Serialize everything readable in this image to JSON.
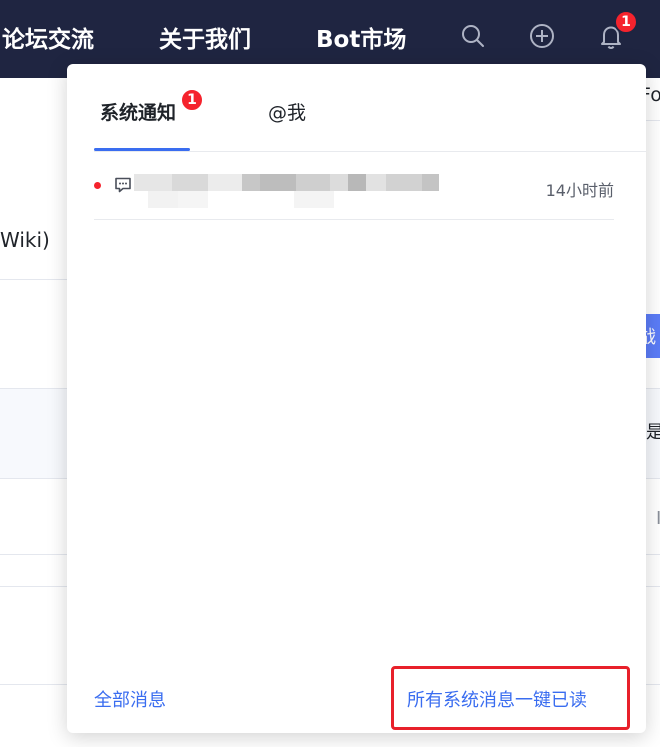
{
  "navbar": {
    "links": [
      "论坛交流",
      "关于我们",
      "Bot市场"
    ],
    "icons": [
      "search-icon",
      "plus-circle-icon",
      "bell-icon"
    ],
    "bell_badge": "1"
  },
  "background": {
    "texts": [
      "Wiki)",
      "Fo",
      "战",
      "是",
      "I"
    ]
  },
  "notifications": {
    "tabs": [
      {
        "label": "系统通知",
        "badge": "1",
        "active": true
      },
      {
        "label": "@我",
        "active": false
      }
    ],
    "items": [
      {
        "icon": "message-icon",
        "unread": true,
        "text": "",
        "time": "14小时前"
      }
    ],
    "footer": {
      "all_messages": "全部消息",
      "mark_all_read": "所有系统消息一键已读"
    }
  },
  "colors": {
    "navbar_bg": "#1f2541",
    "accent": "#3a6df0",
    "badge": "#f5232d",
    "highlight": "#e8202a"
  }
}
